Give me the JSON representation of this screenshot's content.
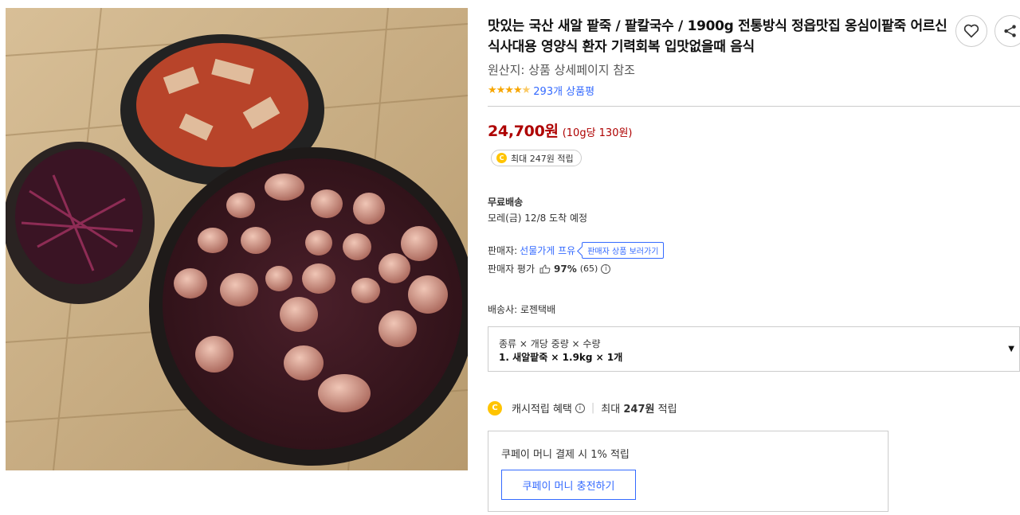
{
  "product": {
    "title": "맛있는 국산 새알 팥죽 / 팥칼국수 / 1900g 전통방식 정읍맛집 옹심이팥죽 어르신 식사대용 영양식 환자 기력회복 입맛없을때 음식",
    "origin": "원산지: 상품 상세페이지 참조",
    "rating_stars": 4.5,
    "review_count": "293개 상품평"
  },
  "price": {
    "amount": "24,700원",
    "unit_price": "(10g당 130원)",
    "reward_badge": "최대 247원 적립",
    "coin_symbol": "C"
  },
  "shipping": {
    "label": "무료배송",
    "arrival": "모레(금) 12/8 도착 예정"
  },
  "seller": {
    "label": "판매자:",
    "name": "선물가게 프유",
    "tooltip": "판매자 상품 보러가기",
    "eval_label": "판매자 평가",
    "eval_pct": "97%",
    "eval_count": "(65)"
  },
  "carrier": "배송사: 로젠택배",
  "option": {
    "header": "종류 × 개당 중량 × 수량",
    "selected": "1. 새알팥죽 × 1.9kg × 1개"
  },
  "cash": {
    "label": "캐시적립 혜택",
    "max_prefix": "최대",
    "max_amount": "247원",
    "max_suffix": "적립"
  },
  "coupay": {
    "text": "쿠페이 머니 결제 시 1% 적립",
    "button": "쿠페이 머니 충전하기"
  },
  "colors": {
    "price": "#ae0000",
    "link": "#346aff",
    "coin": "#ffc400",
    "star": "#f7a600"
  },
  "icons": [
    "heart-icon",
    "share-icon",
    "thumbs-up-icon",
    "info-icon",
    "chevron-down-icon",
    "coin-icon"
  ]
}
